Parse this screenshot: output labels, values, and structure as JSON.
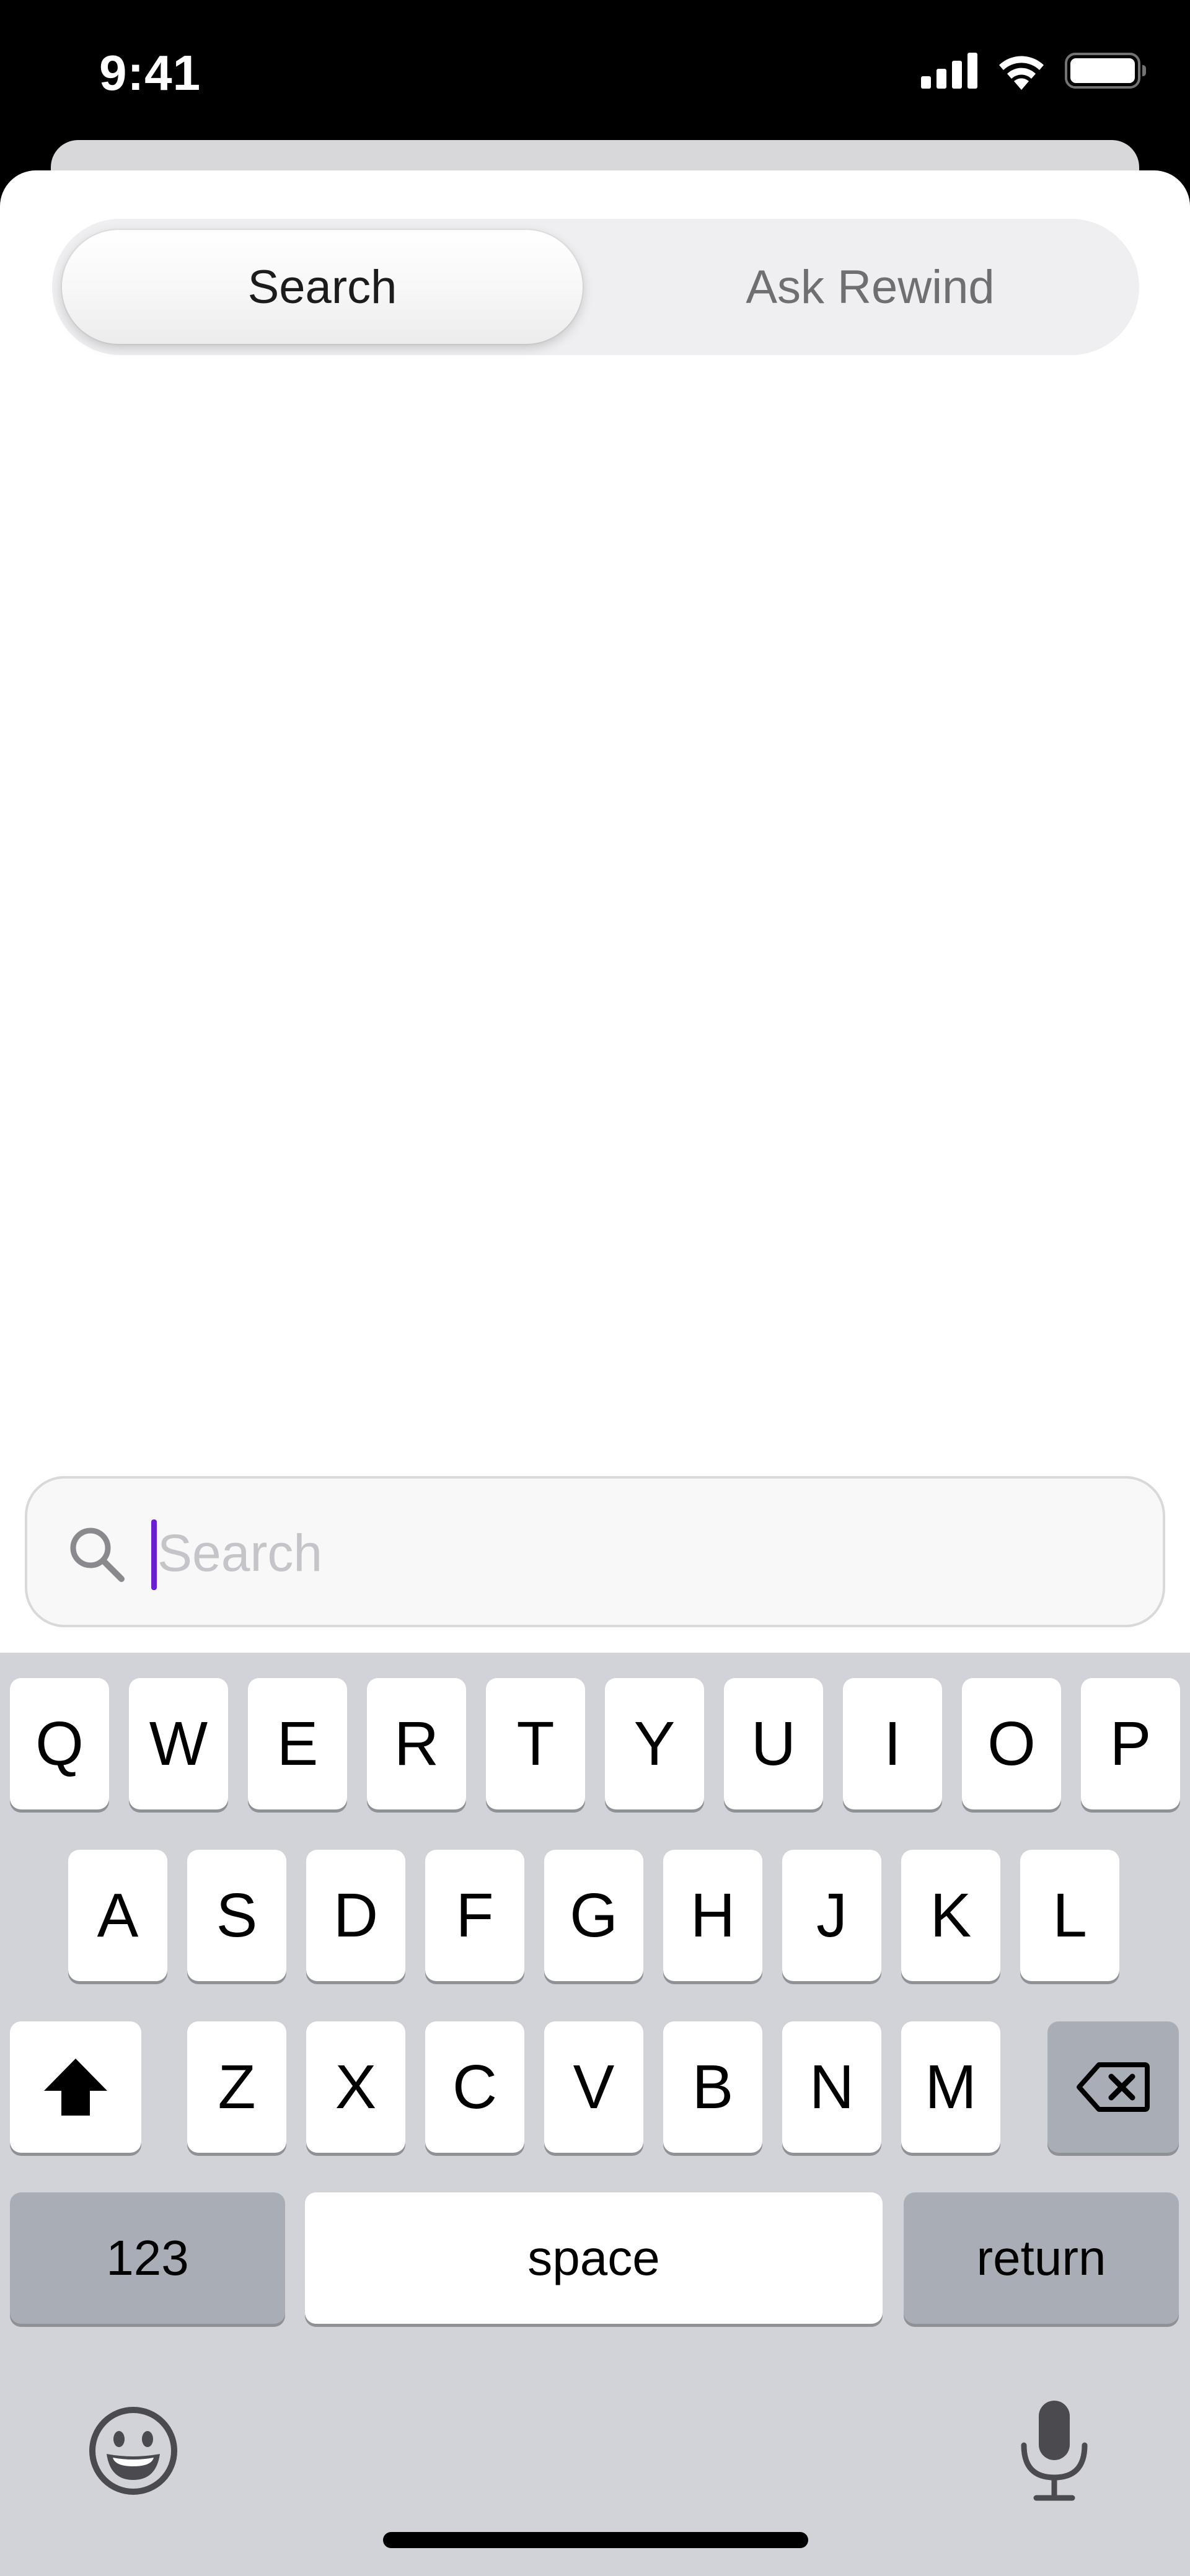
{
  "status_bar": {
    "time": "9:41",
    "icons": [
      "signal-icon",
      "wifi-icon",
      "battery-icon"
    ]
  },
  "segmented_control": {
    "segments": [
      {
        "label": "Search",
        "selected": true
      },
      {
        "label": "Ask Rewind",
        "selected": false
      }
    ]
  },
  "search": {
    "placeholder": "Search",
    "value": "",
    "icon": "search-icon",
    "caret_color": "#6a1fd0"
  },
  "keyboard": {
    "row1": [
      "Q",
      "W",
      "E",
      "R",
      "T",
      "Y",
      "U",
      "I",
      "O",
      "P"
    ],
    "row2": [
      "A",
      "S",
      "D",
      "F",
      "G",
      "H",
      "J",
      "K",
      "L"
    ],
    "row3": [
      "Z",
      "X",
      "C",
      "V",
      "B",
      "N",
      "M"
    ],
    "shift_icon": "shift-arrow-icon",
    "delete_icon": "backspace-icon",
    "numbers_label": "123",
    "space_label": "space",
    "return_label": "return",
    "emoji_icon": "emoji-icon",
    "dictation_icon": "microphone-icon",
    "background_color": "#d1d3d9"
  }
}
